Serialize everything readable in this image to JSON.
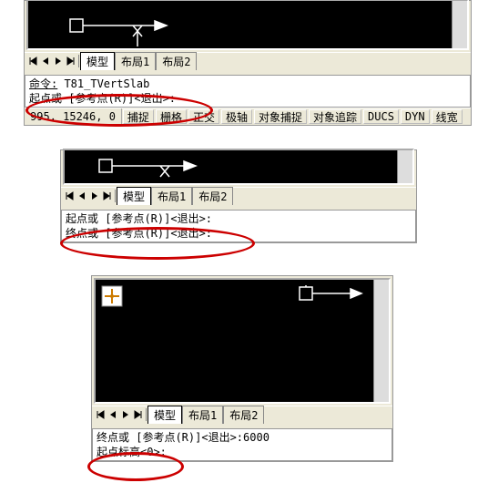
{
  "panel1": {
    "tabs": {
      "active": "模型",
      "t2": "布局1",
      "t3": "布局2"
    },
    "cmd": {
      "line1_label": "命令:",
      "line1_value": " T81_TVertSlab",
      "line2": "起点或 [参考点(R)]<退出>:"
    },
    "status": {
      "coord": "995, 15246, 0",
      "b1": "捕捉",
      "b2": "栅格",
      "b3": "正交",
      "b4": "极轴",
      "b5": "对象捕捉",
      "b6": "对象追踪",
      "b7": "DUCS",
      "b8": "DYN",
      "b9": "线宽"
    }
  },
  "panel2": {
    "tabs": {
      "active": "模型",
      "t2": "布局1",
      "t3": "布局2"
    },
    "cmd": {
      "line1": "起点或 [参考点(R)]<退出>:",
      "line2": "终点或 [参考点(R)]<退出>:"
    }
  },
  "panel3": {
    "tabs": {
      "active": "模型",
      "t2": "布局1",
      "t3": "布局2"
    },
    "cmd": {
      "line1": "终点或 [参考点(R)]<退出>:6000",
      "line2": "起点标高<0>:"
    }
  }
}
